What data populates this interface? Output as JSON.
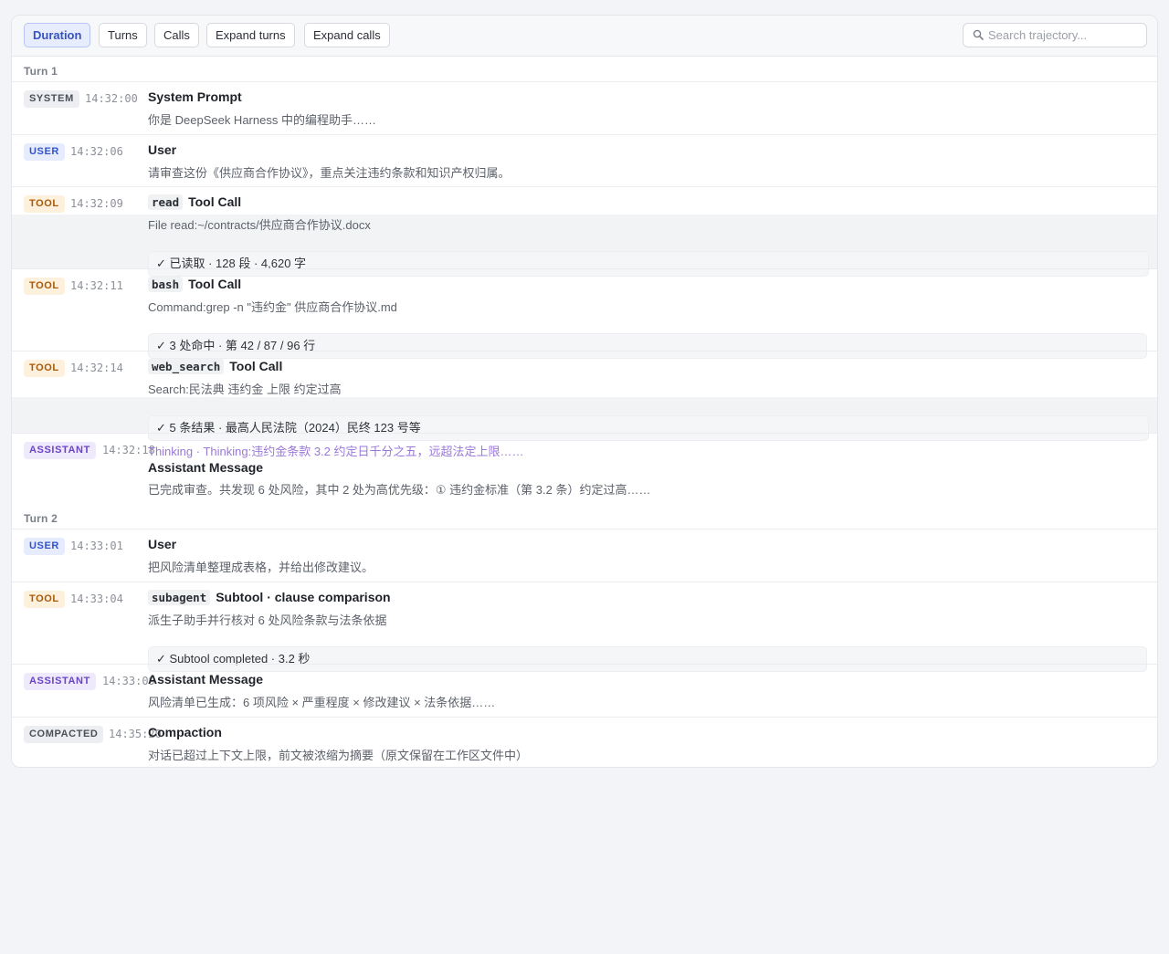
{
  "toolbar": {
    "buttons": [
      "Duration",
      "Turns",
      "Calls",
      "Expand turns",
      "Expand calls"
    ],
    "search_placeholder": "Search trajectory..."
  },
  "turns": [
    {
      "label": "Turn 1",
      "entries": [
        {
          "badge": "SYSTEM",
          "time": "14:32:00",
          "title": "System Prompt",
          "desc": "你是 DeepSeek Harness 中的编程助手……"
        },
        {
          "badge": "USER",
          "time": "14:32:06",
          "title": "User",
          "desc": "请审查这份《供应商合作协议》，重点关注违约条款和知识产权归属。"
        },
        {
          "badge": "TOOL",
          "time": "14:32:09",
          "tool": "read",
          "title": "Tool Call",
          "desc": "File read:~/contracts/供应商合作协议.docx",
          "result": "✓ 已读取 · 128 段 · 4,620 字"
        },
        {
          "badge": "TOOL",
          "time": "14:32:11",
          "tool": "bash",
          "title": "Tool Call",
          "desc": "Command:grep -n \"违约金\" 供应商合作协议.md",
          "result": "✓ 3 处命中 · 第 42 / 87 / 96 行"
        },
        {
          "badge": "TOOL",
          "time": "14:32:14",
          "tool": "web_search",
          "title": "Tool Call",
          "desc": "Search:民法典 违约金 上限 约定过高",
          "result": "✓ 5 条结果 · 最高人民法院（2024）民终 123 号等"
        },
        {
          "badge": "ASSISTANT",
          "time": "14:32:18",
          "thinking": "Thinking · Thinking:违约金条款 3.2 约定日千分之五，远超法定上限……",
          "title": "Assistant Message",
          "desc": "已完成审查。共发现 6 处风险，其中 2 处为高优先级：① 违约金标准（第 3.2 条）约定过高……"
        }
      ]
    },
    {
      "label": "Turn 2",
      "entries": [
        {
          "badge": "USER",
          "time": "14:33:01",
          "title": "User",
          "desc": "把风险清单整理成表格，并给出修改建议。"
        },
        {
          "badge": "TOOL",
          "time": "14:33:04",
          "tool": "subagent",
          "title": "Subtool · clause comparison",
          "desc": "派生子助手并行核对 6 处风险条款与法条依据",
          "result": "✓ Subtool completed · 3.2 秒"
        },
        {
          "badge": "ASSISTANT",
          "time": "14:33:09",
          "title": "Assistant Message",
          "desc": "风险清单已生成：6 项风险 × 严重程度 × 修改建议 × 法条依据……"
        },
        {
          "badge": "COMPACTED",
          "time": "14:35:20",
          "title": "Compaction",
          "desc": "对话已超过上下文上限，前文被浓缩为摘要（原文保留在工作区文件中）"
        }
      ]
    }
  ]
}
